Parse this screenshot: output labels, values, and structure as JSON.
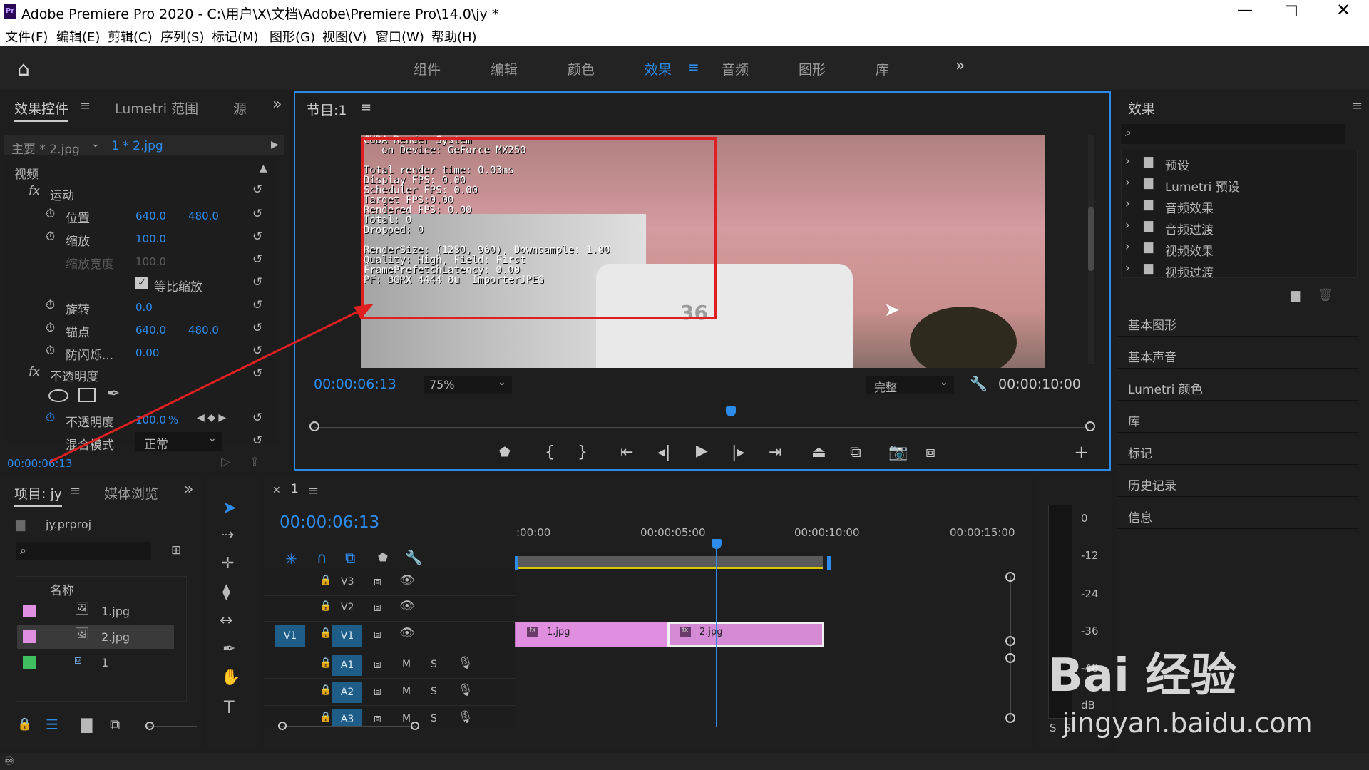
{
  "app": {
    "title": "Adobe Premiere Pro 2020 - C:\\用户\\X\\文档\\Adobe\\Premiere Pro\\14.0\\jy *",
    "logo": "Pr"
  },
  "menu": [
    "文件(F)",
    "编辑(E)",
    "剪辑(C)",
    "序列(S)",
    "标记(M)",
    "图形(G)",
    "视图(V)",
    "窗口(W)",
    "帮助(H)"
  ],
  "workspaces": [
    "组件",
    "编辑",
    "颜色",
    "效果",
    "音频",
    "图形",
    "库"
  ],
  "effect_controls": {
    "tabs": [
      "效果控件",
      "Lumetri 范围",
      "源"
    ],
    "master": "主要 * 2.jpg",
    "clip": "1 * 2.jpg",
    "section": "视频",
    "motion": "运动",
    "position_label": "位置",
    "pos_x": "640.0",
    "pos_y": "480.0",
    "scale_label": "缩放",
    "scale": "100.0",
    "scale_width_label": "缩放宽度",
    "scale_width": "100.0",
    "uniform": "等比缩放",
    "rotation_label": "旋转",
    "rotation": "0.0",
    "anchor_label": "锚点",
    "anchor_x": "640.0",
    "anchor_y": "480.0",
    "flicker_label": "防闪烁...",
    "flicker": "0.00",
    "opacity": "不透明度",
    "opacity_label": "不透明度",
    "opacity_value": "100.0",
    "opacity_unit": "%",
    "blend_label": "混合模式",
    "blend": "正常",
    "timecode": "00:00:06:13"
  },
  "program": {
    "title": "节目:1",
    "timecode": "00:00:06:13",
    "zoom": "75%",
    "quality": "完整",
    "duration": "00:00:10:00",
    "overlay": [
      "CUDA Render System",
      "   on Device: GeForce MX250",
      "",
      "Total render time: 0.03ms",
      "Display FPS: 0.00",
      "Scheduler FPS: 0.00",
      "Target FPS:0.00",
      "Rendered FPS: 0.00",
      "Total: 0",
      "Dropped: 0",
      "",
      "RenderSize: (1280, 960), Downsample: 1.00",
      "Quality: High, Field: First",
      "FramePrefetchLatency: 0.00",
      "PF: BGRX 4444 8u  ImporterJPEG"
    ],
    "truck_number": "36"
  },
  "effects_panel": {
    "title": "效果",
    "items": [
      "预设",
      "Lumetri 预设",
      "音频效果",
      "音频过渡",
      "视频效果",
      "视频过渡"
    ],
    "sections": [
      "基本图形",
      "基本声音",
      "Lumetri 颜色",
      "库",
      "标记",
      "历史记录",
      "信息"
    ]
  },
  "project": {
    "tabs": [
      "项目: jy",
      "媒体浏览"
    ],
    "file": "jy.prproj",
    "col_name": "名称",
    "items": [
      {
        "name": "1.jpg",
        "color": "#e08ee0"
      },
      {
        "name": "2.jpg",
        "color": "#e08ee0"
      },
      {
        "name": "1",
        "color": "#3fbf5f"
      }
    ]
  },
  "timeline": {
    "tab": "1",
    "timecode": "00:00:06:13",
    "ruler": [
      ":00:00",
      "00:00:05:00",
      "00:00:10:00",
      "00:00:15:00"
    ],
    "video_tracks": [
      "V3",
      "V2",
      "V1"
    ],
    "audio_tracks": [
      "A1",
      "A2",
      "A3"
    ],
    "source_patch": "V1",
    "m": "M",
    "s": "S",
    "clips": [
      "1.jpg",
      "2.jpg"
    ]
  },
  "meter": {
    "labels": [
      "0",
      "-12",
      "-24",
      "-36",
      "-48",
      "dB"
    ],
    "s": "S",
    "s2": "S"
  },
  "watermark": {
    "text": "Bai 经验",
    "url": "jingyan.baidu.com"
  }
}
